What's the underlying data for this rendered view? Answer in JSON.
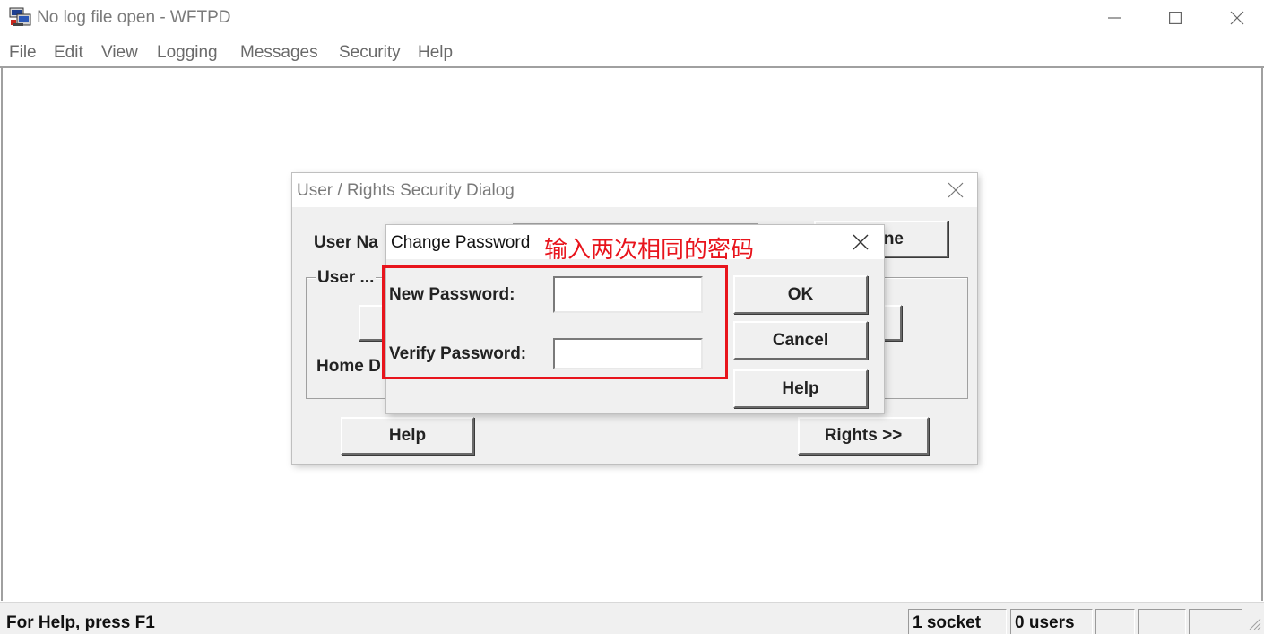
{
  "window": {
    "title": "No log file open - WFTPD",
    "icon": "wftpd-app-icon",
    "controls": [
      "minimize-icon",
      "maximize-icon",
      "close-icon"
    ]
  },
  "menubar": {
    "items": [
      {
        "label": "File"
      },
      {
        "label": "Edit"
      },
      {
        "label": "View"
      },
      {
        "label": "Logging"
      },
      {
        "label": "Messages"
      },
      {
        "label": "Security"
      },
      {
        "label": "Help"
      }
    ]
  },
  "security_dialog": {
    "title": "User / Rights Security Dialog",
    "user_name_label": "User Na",
    "rename_button_fragment": "ne",
    "user_group_title": "User ...",
    "home_dir_label": "Home D",
    "help_button": "Help",
    "rights_button": "Rights >>"
  },
  "change_password_dialog": {
    "title": "Change Password",
    "annotation": "输入两次相同的密码",
    "new_password_label": "New Password:",
    "new_password_value": "",
    "verify_password_label": "Verify Password:",
    "verify_password_value": "",
    "ok_button": "OK",
    "cancel_button": "Cancel",
    "help_button": "Help"
  },
  "colors": {
    "annotation": "#e8141c",
    "title_text": "#7a7a7a",
    "dialog_face": "#f0f0f0"
  },
  "statusbar": {
    "help_text": "For Help, press F1",
    "sockets": "1 socket",
    "users": "0 users"
  }
}
